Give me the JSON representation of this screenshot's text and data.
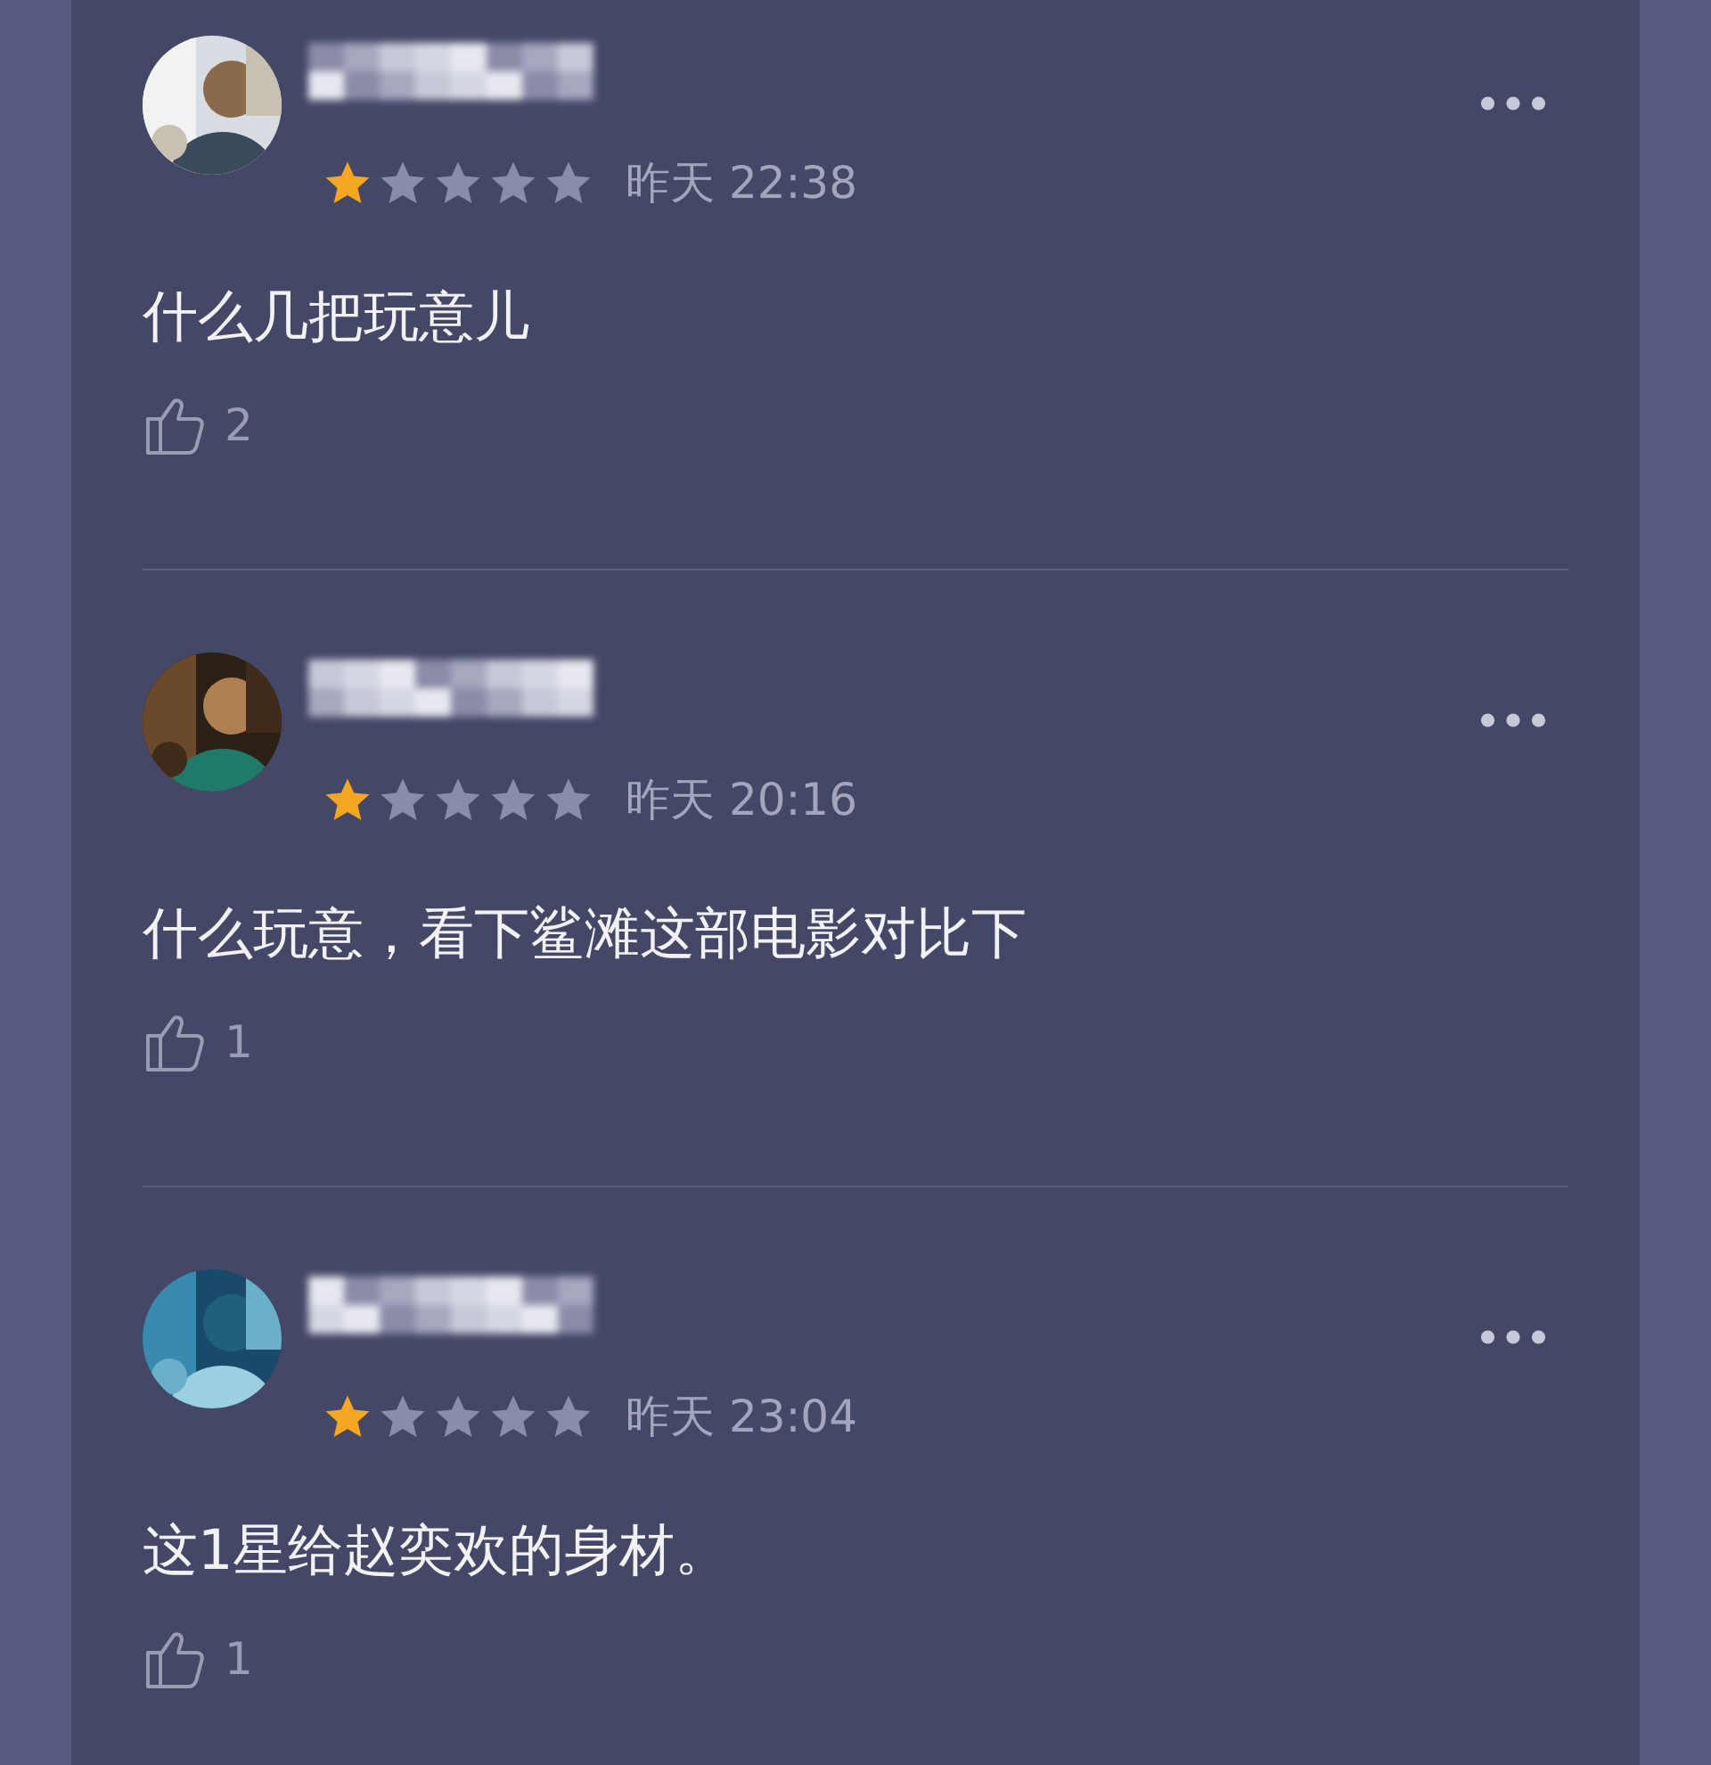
{
  "comments": [
    {
      "stars": 1,
      "time": "昨天 22:38",
      "text": "什么几把玩意儿",
      "likes": "2"
    },
    {
      "stars": 1,
      "time": "昨天 20:16",
      "text": "什么玩意，看下鲨滩这部电影对比下",
      "likes": "1"
    },
    {
      "stars": 1,
      "time": "昨天 23:04",
      "text": "这1星给赵奕欢的身材。",
      "likes": "1"
    }
  ]
}
